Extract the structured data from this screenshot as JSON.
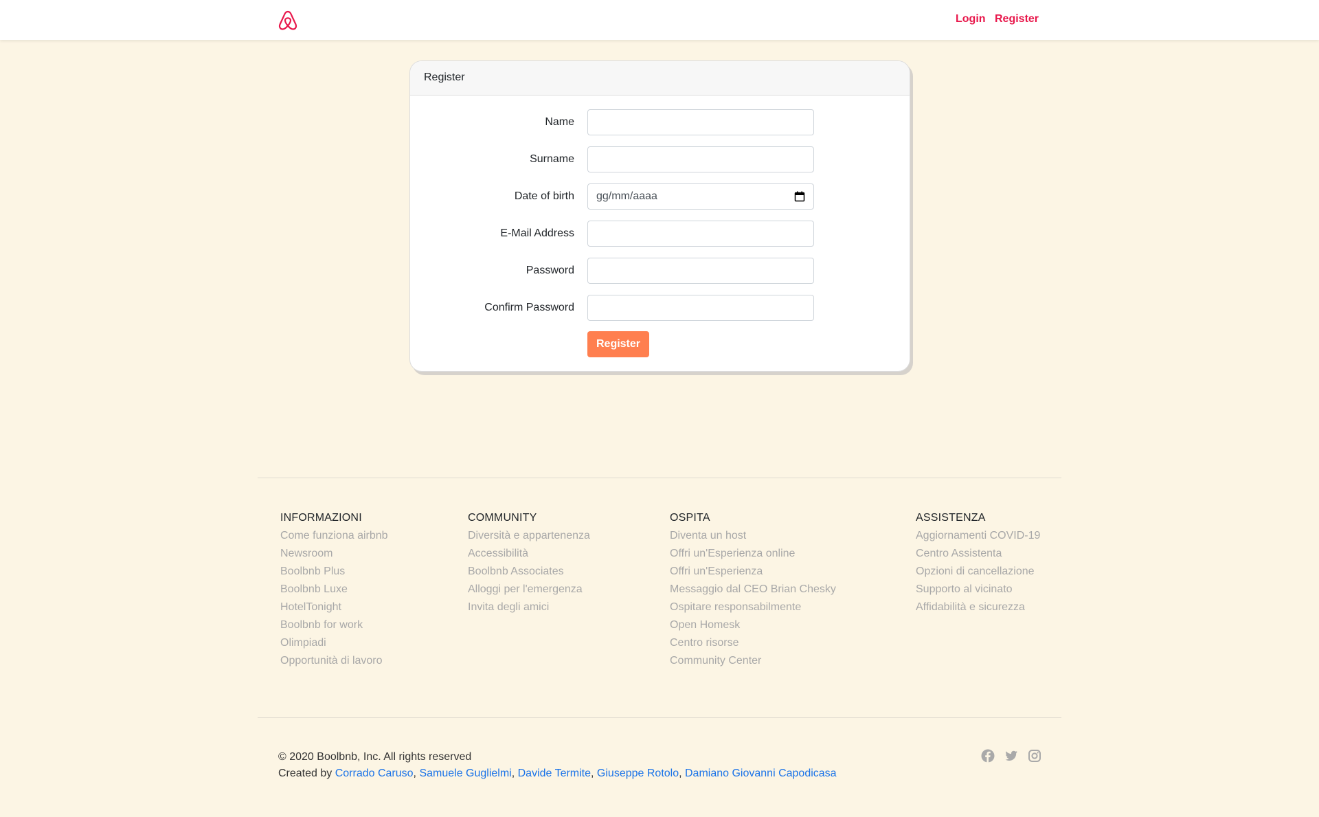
{
  "header": {
    "logo_icon": "airbnb-logo-icon",
    "nav": {
      "login": "Login",
      "register": "Register"
    },
    "accent_color": "#e8174b"
  },
  "register_card": {
    "title": "Register",
    "fields": {
      "name": {
        "label": "Name",
        "value": ""
      },
      "surname": {
        "label": "Surname",
        "value": ""
      },
      "dob": {
        "label": "Date of birth",
        "placeholder": "gg/mm/aaaa"
      },
      "email": {
        "label": "E-Mail Address",
        "value": ""
      },
      "password": {
        "label": "Password",
        "value": ""
      },
      "confirm_password": {
        "label": "Confirm Password",
        "value": ""
      }
    },
    "submit_label": "Register",
    "button_color": "#ff7f4f"
  },
  "footer": {
    "columns": [
      {
        "title": "INFORMAZIONI",
        "items": [
          "Come funziona airbnb",
          "Newsroom",
          "Boolbnb Plus",
          "Boolbnb Luxe",
          "HotelTonight",
          "Boolbnb for work",
          "Olimpiadi",
          "Opportunità di lavoro"
        ]
      },
      {
        "title": "COMMUNITY",
        "items": [
          "Diversità e appartenenza",
          "Accessibilità",
          "Boolbnb Associates",
          "Alloggi per l'emergenza",
          "Invita degli amici"
        ]
      },
      {
        "title": "OSPITA",
        "items": [
          "Diventa un host",
          "Offri un'Esperienza online",
          "Offri un'Esperienza",
          "Messaggio dal CEO Brian Chesky",
          "Ospitare responsabilmente",
          "Open Homesk",
          "Centro risorse",
          "Community Center"
        ]
      },
      {
        "title": "ASSISTENZA",
        "items": [
          "Aggiornamenti COVID-19",
          "Centro Assistenta",
          "Opzioni di cancellazione",
          "Supporto al vicinato",
          "Affidabilità e sicurezza"
        ]
      }
    ],
    "copyright": "© 2020 Boolbnb, Inc. All rights reserved",
    "created_by_label": "Created by",
    "authors": [
      "Corrado Caruso",
      "Samuele Guglielmi",
      "Davide Termite",
      "Giuseppe Rotolo",
      "Damiano Giovanni Capodicasa"
    ],
    "social_icons": [
      "facebook-icon",
      "twitter-icon",
      "instagram-icon"
    ]
  }
}
